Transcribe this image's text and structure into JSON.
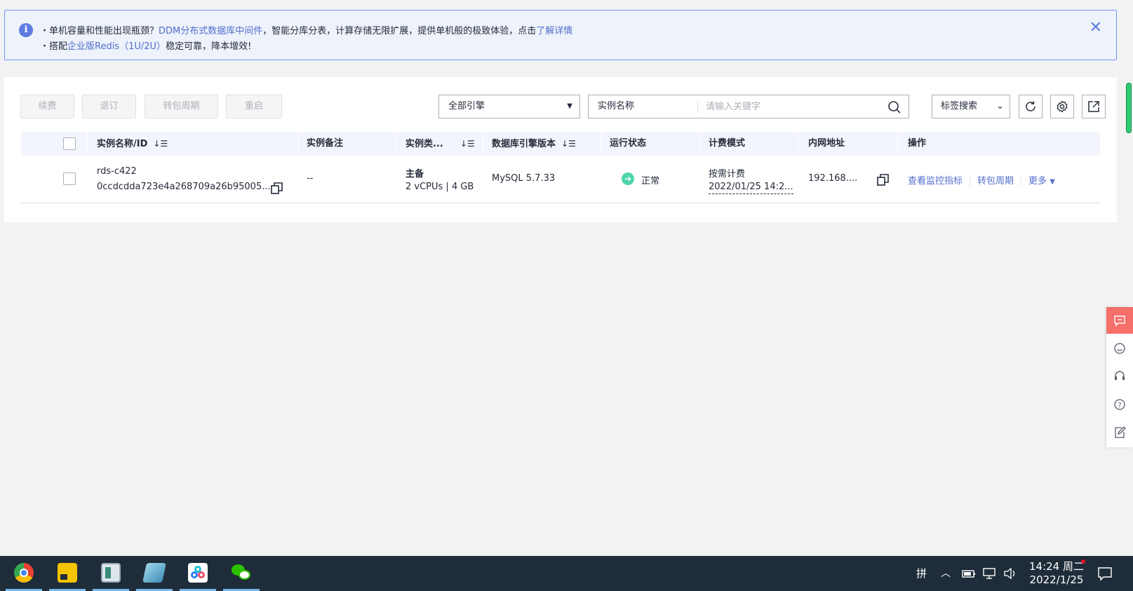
{
  "notice": {
    "line1_prefix": "・单机容量和性能出现瓶颈？",
    "line1_link": "DDM分布式数据库中间件",
    "line1_middle": "，智能分库分表，计算存储无限扩展，提供单机般的极致体验，点击",
    "line1_detail_link": "了解详情",
    "line2_prefix": "・搭配",
    "line2_link": "企业版Redis（1U/2U）",
    "line2_suffix": "稳定可靠，降本增效!",
    "close": "✕"
  },
  "toolbar": {
    "renew": "续费",
    "unsubscribe": "退订",
    "change_billing": "转包周期",
    "restart": "重启",
    "engine_select": "全部引擎",
    "search_field_select": "实例名称",
    "search_placeholder": "请输入关键字",
    "tag_search": "标签搜索"
  },
  "table": {
    "headers": {
      "name": "实例名称/ID",
      "remark": "实例备注",
      "type": "实例类...",
      "engine": "数据库引擎版本",
      "status": "运行状态",
      "billing": "计费模式",
      "ip": "内网地址",
      "ops": "操作"
    },
    "rows": [
      {
        "name": "rds-c422",
        "id": "0ccdcdda723e4a268709a26b95005...",
        "remark": "--",
        "type_line1": "主备",
        "type_line2": "2 vCPUs | 4 GB",
        "engine": "MySQL 5.7.33",
        "status": "正常",
        "billing_mode": "按需计费",
        "billing_time": "2022/01/25 14:2...",
        "ip": "192.168....",
        "op_monitor": "查看监控指标",
        "op_change": "转包周期",
        "op_more": "更多"
      }
    ]
  },
  "taskbar": {
    "ime": "拼",
    "time": "14:24 周二",
    "date": "2022/1/25"
  },
  "colors": {
    "accent": "#526ecc",
    "status_ok": "#50d4ab",
    "float_active": "#f66f6a",
    "taskbar": "#1f2d3a"
  }
}
